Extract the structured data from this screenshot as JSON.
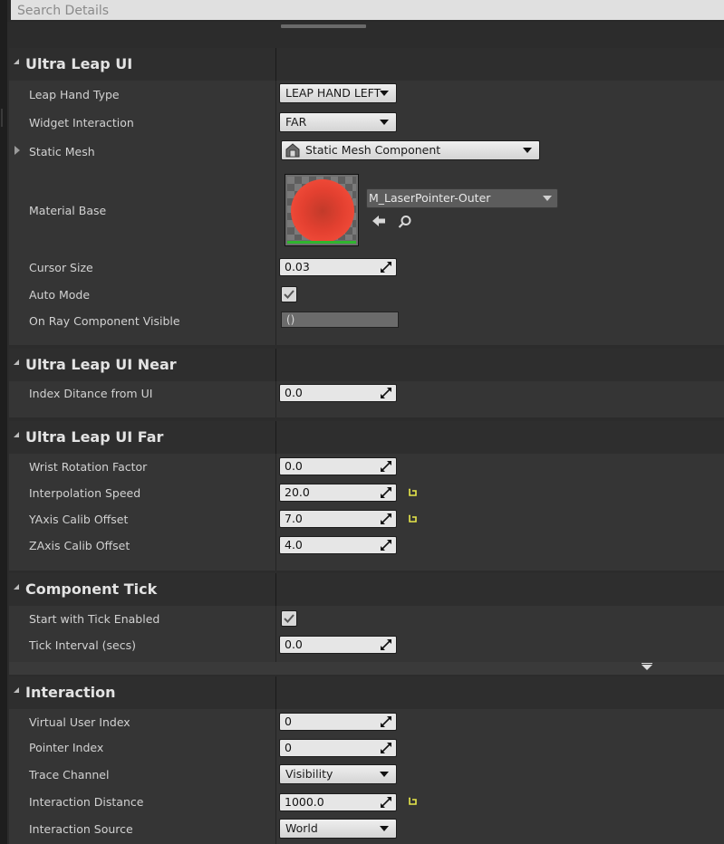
{
  "search": {
    "placeholder": "Search Details"
  },
  "sections": {
    "ultra_leap_ui": {
      "title": "Ultra Leap UI",
      "leap_hand_type": {
        "label": "Leap Hand Type",
        "value": "LEAP HAND LEFT"
      },
      "widget_interaction": {
        "label": "Widget Interaction",
        "value": "FAR"
      },
      "static_mesh": {
        "label": "Static Mesh",
        "value": "Static Mesh Component"
      },
      "material_base": {
        "label": "Material Base",
        "value": "M_LaserPointer-Outer"
      },
      "cursor_size": {
        "label": "Cursor Size",
        "value": "0.03"
      },
      "auto_mode": {
        "label": "Auto Mode",
        "checked": true
      },
      "on_ray_component_visible": {
        "label": "On Ray Component Visible",
        "value": "()"
      }
    },
    "ultra_leap_ui_near": {
      "title": "Ultra Leap UI Near",
      "index_distance": {
        "label": "Index Ditance from UI",
        "value": "0.0"
      }
    },
    "ultra_leap_ui_far": {
      "title": "Ultra Leap UI Far",
      "wrist_rotation": {
        "label": "Wrist Rotation Factor",
        "value": "0.0"
      },
      "interpolation_speed": {
        "label": "Interpolation Speed",
        "value": "20.0"
      },
      "yaxis_offset": {
        "label": "YAxis Calib Offset",
        "value": "7.0"
      },
      "zaxis_offset": {
        "label": "ZAxis Calib Offset",
        "value": "4.0"
      }
    },
    "component_tick": {
      "title": "Component Tick",
      "start_with_tick": {
        "label": "Start with Tick Enabled",
        "checked": true
      },
      "tick_interval": {
        "label": "Tick Interval (secs)",
        "value": "0.0"
      }
    },
    "interaction": {
      "title": "Interaction",
      "virtual_user_index": {
        "label": "Virtual User Index",
        "value": "0"
      },
      "pointer_index": {
        "label": "Pointer Index",
        "value": "0"
      },
      "trace_channel": {
        "label": "Trace Channel",
        "value": "Visibility"
      },
      "interaction_distance": {
        "label": "Interaction Distance",
        "value": "1000.0"
      },
      "interaction_source": {
        "label": "Interaction Source",
        "value": "World"
      }
    }
  },
  "colors": {
    "reset_arrow": "#e8e84a",
    "section_bg": "#2e2e2e",
    "row_bg": "#353535"
  },
  "icons": [
    "static-mesh-icon",
    "use-selected-arrow-icon",
    "browse-magnifier-icon",
    "reset-to-default-icon",
    "resize-drag-icon",
    "expand-triangle-icon",
    "checkbox-check-icon"
  ]
}
